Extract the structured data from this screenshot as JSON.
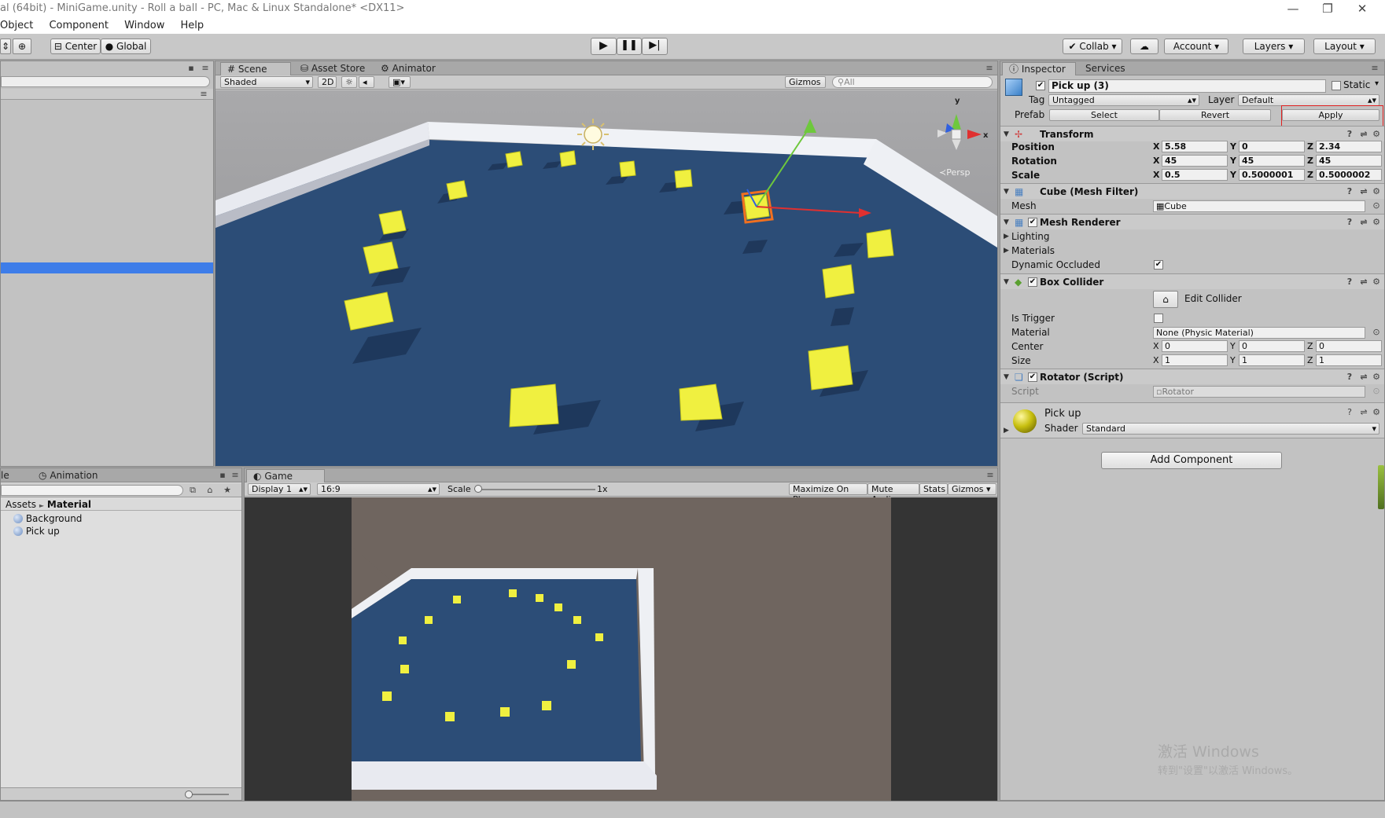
{
  "window": {
    "title": "al (64bit) - MiniGame.unity - Roll a ball - PC, Mac & Linux Standalone* <DX11>",
    "minimize": "—",
    "restore": "❐",
    "close": "✕"
  },
  "menu": [
    "Object",
    "Component",
    "Window",
    "Help"
  ],
  "toolbar": {
    "pivot": "Center",
    "space": "Global",
    "collab": "Collab",
    "account": "Account",
    "layers": "Layers",
    "layout": "Layout"
  },
  "scene": {
    "tabs": [
      "Scene",
      "Asset Store",
      "Animator"
    ],
    "shading": "Shaded",
    "mode_2d": "2D",
    "gizmos": "Gizmos",
    "search_placeholder": "All",
    "persp_label": "Persp",
    "axis_y": "y",
    "axis_x": "x"
  },
  "game": {
    "tab": "Game",
    "display": "Display 1",
    "aspect": "16:9",
    "scale_label": "Scale",
    "scale_value": "1x",
    "maximize": "Maximize On Play",
    "mute": "Mute Audio",
    "stats": "Stats",
    "gizmos": "Gizmos"
  },
  "project": {
    "tab_left": "le",
    "tab_animation": "Animation",
    "breadcrumb_root": "Assets",
    "breadcrumb_sep": "►",
    "breadcrumb_current": "Material",
    "items": [
      "Background",
      "Pick up"
    ]
  },
  "inspector": {
    "tabs": [
      "Inspector",
      "Services"
    ],
    "object_name": "Pick up (3)",
    "static_label": "Static",
    "tag_label": "Tag",
    "tag_value": "Untagged",
    "layer_label": "Layer",
    "layer_value": "Default",
    "prefab_label": "Prefab",
    "prefab_select": "Select",
    "prefab_revert": "Revert",
    "prefab_apply": "Apply",
    "transform": {
      "title": "Transform",
      "position_label": "Position",
      "rotation_label": "Rotation",
      "scale_label": "Scale",
      "position": [
        "5.58",
        "0",
        "2.34"
      ],
      "rotation": [
        "45",
        "45",
        "45"
      ],
      "scale": [
        "0.5",
        "0.5000001",
        "0.5000002"
      ]
    },
    "mesh_filter": {
      "title": "Cube (Mesh Filter)",
      "mesh_label": "Mesh",
      "mesh_value": "Cube"
    },
    "mesh_renderer": {
      "title": "Mesh Renderer",
      "lighting": "Lighting",
      "materials": "Materials",
      "dynamic_occluded": "Dynamic Occluded"
    },
    "box_collider": {
      "title": "Box Collider",
      "edit_collider": "Edit Collider",
      "is_trigger": "Is Trigger",
      "material_label": "Material",
      "material_value": "None (Physic Material)",
      "center_label": "Center",
      "center": [
        "0",
        "0",
        "0"
      ],
      "size_label": "Size",
      "size": [
        "1",
        "1",
        "1"
      ]
    },
    "rotator": {
      "title": "Rotator (Script)",
      "script_label": "Script",
      "script_value": "Rotator"
    },
    "material": {
      "name": "Pick up",
      "shader_label": "Shader",
      "shader_value": "Standard"
    },
    "add_component": "Add Component",
    "axis_labels": [
      "X",
      "Y",
      "Z"
    ]
  },
  "watermark": {
    "line1": "激活 Windows",
    "line2": "转到\"设置\"以激活 Windows。"
  },
  "colors": {
    "floor": "#2c4d77",
    "wall": "#e8eaf0",
    "pickup": "#f0f040",
    "selection_blue": "#3e7de9",
    "apply_highlight": "#e02020"
  }
}
